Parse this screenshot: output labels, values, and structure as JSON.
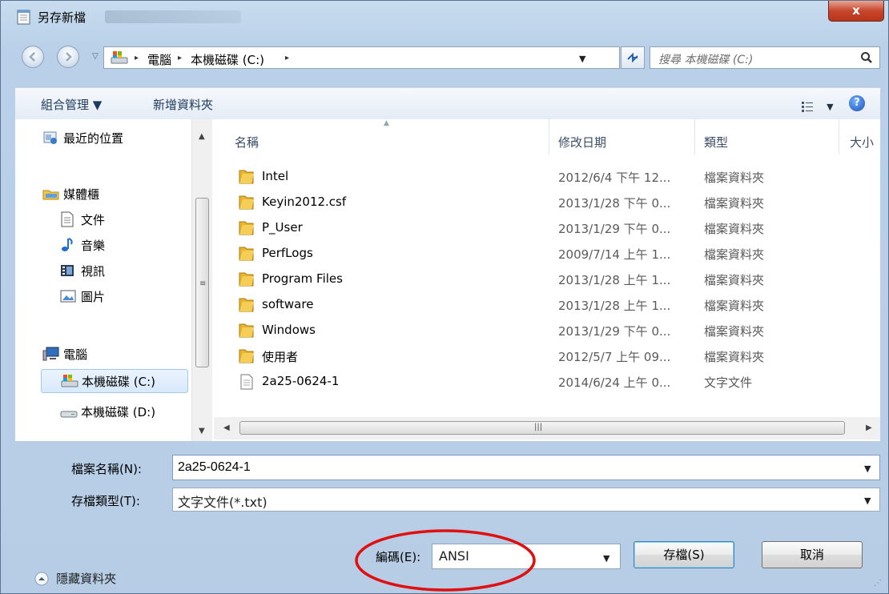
{
  "window": {
    "title": "另存新檔",
    "close_label": "x"
  },
  "address": {
    "history_arrow": "▽",
    "parts": [
      "電腦",
      "本機磁碟 (C:)"
    ],
    "separator": "▸",
    "search_placeholder": "搜尋 本機磁碟 (C:)"
  },
  "toolbar": {
    "organize": "組合管理 ▼",
    "new_folder": "新增資料夾",
    "view_arrow": "▼",
    "help": "?"
  },
  "nav": {
    "items": [
      {
        "label": "最近的位置",
        "icon": "recent-places-icon"
      },
      {
        "label": "媒體櫃",
        "icon": "libraries-icon"
      },
      {
        "label": "文件",
        "icon": "documents-icon"
      },
      {
        "label": "音樂",
        "icon": "music-icon"
      },
      {
        "label": "視訊",
        "icon": "video-icon"
      },
      {
        "label": "圖片",
        "icon": "pictures-icon"
      },
      {
        "label": "電腦",
        "icon": "computer-icon"
      },
      {
        "label": "本機磁碟 (C:)",
        "icon": "drive-c-icon"
      },
      {
        "label": "本機磁碟 (D:)",
        "icon": "drive-d-icon"
      }
    ]
  },
  "columns": {
    "name": "名稱",
    "modified": "修改日期",
    "type": "類型",
    "size": "大小"
  },
  "files": [
    {
      "name": "Intel",
      "date": "2012/6/4 下午 12...",
      "type": "檔案資料夾",
      "kind": "folder"
    },
    {
      "name": "Keyin2012.csf",
      "date": "2013/1/28 下午 0...",
      "type": "檔案資料夾",
      "kind": "folder"
    },
    {
      "name": "P_User",
      "date": "2013/1/29 下午 0...",
      "type": "檔案資料夾",
      "kind": "folder"
    },
    {
      "name": "PerfLogs",
      "date": "2009/7/14 上午 1...",
      "type": "檔案資料夾",
      "kind": "folder"
    },
    {
      "name": "Program Files",
      "date": "2013/1/28 上午 1...",
      "type": "檔案資料夾",
      "kind": "folder"
    },
    {
      "name": "software",
      "date": "2013/1/28 上午 1...",
      "type": "檔案資料夾",
      "kind": "folder"
    },
    {
      "name": "Windows",
      "date": "2013/1/29 下午 0...",
      "type": "檔案資料夾",
      "kind": "folder"
    },
    {
      "name": "使用者",
      "date": "2012/5/7 上午 09...",
      "type": "檔案資料夾",
      "kind": "folder"
    },
    {
      "name": "2a25-0624-1",
      "date": "2014/6/24 上午 0...",
      "type": "文字文件",
      "kind": "text-file"
    }
  ],
  "form": {
    "filename_label": "檔案名稱(N):",
    "filename_value": "2a25-0624-1",
    "filetype_label": "存檔類型(T):",
    "filetype_value": "文字文件(*.txt)",
    "hide_folders_label": "隱藏資料夾",
    "encoding_label": "編碼(E):",
    "encoding_value": "ANSI",
    "save_label": "存檔(S)",
    "cancel_label": "取消"
  },
  "colors": {
    "annotation_ellipse": "#e01010",
    "title_bar": "#b9d0e8",
    "toolbar_text": "#1e395b"
  }
}
